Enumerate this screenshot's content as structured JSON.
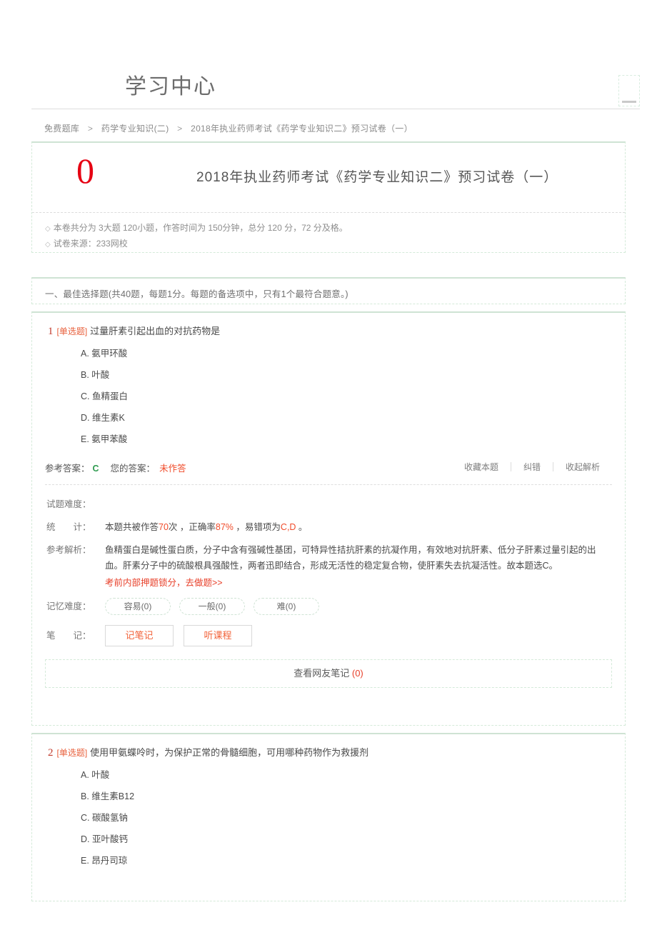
{
  "header": {
    "logo": "学习中心"
  },
  "breadcrumb": {
    "separator": ">",
    "items": [
      "免费题库",
      "药学专业知识(二)",
      "2018年执业药师考试《药学专业知识二》预习试卷（一）"
    ]
  },
  "paper": {
    "score": "0",
    "title": "2018年执业药师考试《药学专业知识二》预习试卷（一）",
    "meta": [
      "本卷共分为 3大题 120小题，作答时间为 150分钟，总分 120 分，72 分及格。",
      "试卷来源：233网校"
    ],
    "bullet": "◇"
  },
  "section": {
    "title": "一、最佳选择题(共40题，每题1分。每题的备选项中，只有1个最符合题意。)"
  },
  "questions": [
    {
      "num": "1",
      "type": "[单选题]",
      "stem": "过量肝素引起出血的对抗药物是",
      "options": [
        "A. 氨甲环酸",
        "B. 叶酸",
        "C. 鱼精蛋白",
        "D. 维生素K",
        "E. 氨甲苯酸"
      ],
      "answer_bar": {
        "ref_label": "参考答案：",
        "ref_value": "C",
        "your_label": "您的答案：",
        "your_value": "未作答",
        "actions": [
          "收藏本题",
          "纠错",
          "收起解析"
        ]
      },
      "analysis": {
        "difficulty_label": "试题难度：",
        "difficulty_value": "",
        "stat_label": "统　　计：",
        "stat_prefix": "本题共被作答",
        "stat_count": "70",
        "stat_mid": "次 ，正确率",
        "stat_rate": "87%",
        "stat_mid2": " ，易错项为",
        "stat_wrong": "C,D",
        "stat_suffix": " 。",
        "explain_label": "参考解析：",
        "explain_text": "鱼精蛋白是碱性蛋白质，分子中含有强碱性基团，可特异性拮抗肝素的抗凝作用，有效地对抗肝素、低分子肝素过量引起的出血。肝素分子中的硫酸根具强酸性，两者迅即结合，形成无活性的稳定复合物，使肝素失去抗凝活性。故本题选C。",
        "promo_text": "考前内部押题锁分，去做题>>",
        "memory_label": "记忆难度：",
        "memory_pills": [
          "容易(0)",
          "一般(0)",
          "难(0)"
        ],
        "note_label": "笔　　记：",
        "note_buttons": [
          "记笔记",
          "听课程"
        ],
        "friend_notes_label": "查看网友笔记",
        "friend_notes_count": "(0)"
      }
    },
    {
      "num": "2",
      "type": "[单选题]",
      "stem": "使用甲氨蝶呤时，为保护正常的骨髓细胞，可用哪种药物作为救援剂",
      "options": [
        "A. 叶酸",
        "B. 维生素B12",
        "C. 碳酸氢钠",
        "D. 亚叶酸钙",
        "E. 昂丹司琼"
      ]
    }
  ],
  "colors": {
    "score_red": "#e60012",
    "correct_green": "#2e9b4f",
    "accent_orange": "#f04b2a",
    "card_border": "#d4ead9"
  }
}
